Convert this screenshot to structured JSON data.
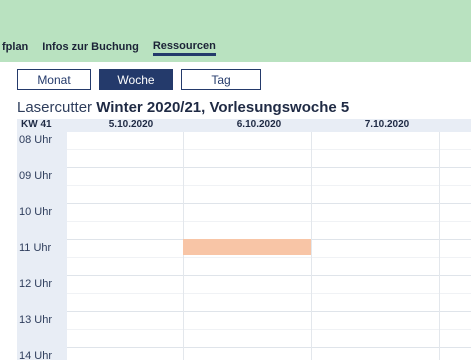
{
  "nav": {
    "tabs": [
      {
        "label": "fplan",
        "active": false
      },
      {
        "label": "Infos zur Buchung",
        "active": false
      },
      {
        "label": "Ressourcen",
        "active": true
      }
    ]
  },
  "view_switch": {
    "month": "Monat",
    "week": "Woche",
    "day": "Tag",
    "active": "Woche"
  },
  "title": {
    "resource": "Lasercutter",
    "period": "Winter 2020/21, Vorlesungswoche 5"
  },
  "calendar": {
    "week_label": "KW 41",
    "days": [
      "5.10.2020",
      "6.10.2020",
      "7.10.2020"
    ],
    "hours": [
      "08 Uhr",
      "09 Uhr",
      "10 Uhr",
      "11 Uhr",
      "12 Uhr",
      "13 Uhr",
      "14 Uhr"
    ],
    "booking_color": "#f8c5a6"
  },
  "colors": {
    "header_bg": "#b9e2c0",
    "accent": "#243a6b",
    "grid_header_bg": "#e8edf5"
  }
}
